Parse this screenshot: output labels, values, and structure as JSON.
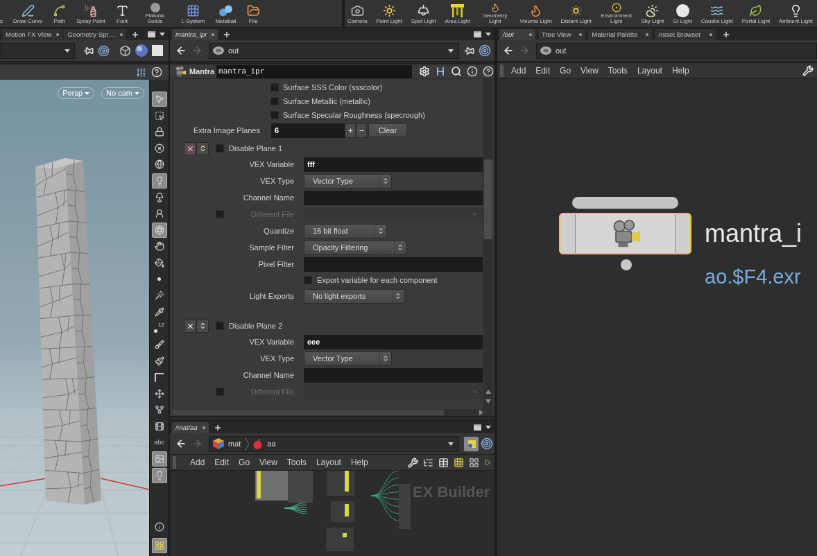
{
  "shelf": {
    "left_tools": [
      {
        "label": "s"
      },
      {
        "label": "Draw Curve"
      },
      {
        "label": "Path"
      },
      {
        "label": "Spray Paint"
      },
      {
        "label": "Font"
      },
      {
        "label": "Platonic Solids"
      },
      {
        "label": "L-System"
      },
      {
        "label": "Metaball"
      },
      {
        "label": "File"
      }
    ],
    "right_tools": [
      {
        "label": "Camera"
      },
      {
        "label": "Point Light"
      },
      {
        "label": "Spot Light"
      },
      {
        "label": "Area Light"
      },
      {
        "label": "Geometry Light"
      },
      {
        "label": "Volume Light"
      },
      {
        "label": "Distant Light"
      },
      {
        "label": "Environment Light"
      },
      {
        "label": "Sky Light"
      },
      {
        "label": "GI Light"
      },
      {
        "label": "Caustic Light"
      },
      {
        "label": "Portal Light"
      },
      {
        "label": "Ambient Light"
      }
    ]
  },
  "viewport_pane": {
    "tabs": [
      {
        "label": "Motion FX View",
        "selected": false
      },
      {
        "label": "Geometry Spr…",
        "selected": false
      }
    ],
    "view_buttons": [
      {
        "label": "Persp"
      },
      {
        "label": "No cam"
      }
    ],
    "toolbar": [
      {
        "kind": "icon",
        "on": true
      },
      {
        "kind": "icon",
        "on": false
      },
      {
        "kind": "icon",
        "on": false
      },
      {
        "kind": "icon",
        "on": false
      },
      {
        "kind": "icon",
        "on": false
      },
      {
        "kind": "icon",
        "on": true
      },
      {
        "kind": "icon",
        "on": false
      },
      {
        "kind": "icon",
        "on": false
      },
      {
        "kind": "icon",
        "on": true
      },
      {
        "kind": "icon",
        "on": false
      },
      {
        "kind": "icon",
        "on": false
      },
      {
        "kind": "icon",
        "on": false
      },
      {
        "kind": "icon",
        "on": false
      },
      {
        "kind": "icon",
        "on": false
      },
      {
        "kind": "icon_label",
        "label": "12",
        "on": false
      },
      {
        "kind": "icon",
        "on": false
      },
      {
        "kind": "icon",
        "on": false
      },
      {
        "kind": "icon",
        "on": false
      },
      {
        "kind": "icon",
        "on": false
      },
      {
        "kind": "icon",
        "on": false
      },
      {
        "kind": "icon",
        "on": false
      },
      {
        "kind": "text",
        "label": "abc",
        "on": false
      },
      {
        "kind": "icon",
        "on": true
      },
      {
        "kind": "icon",
        "on": true
      }
    ],
    "toolbar_bottom": [
      {
        "kind": "icon",
        "on": false
      },
      {
        "kind": "icon",
        "on": true
      }
    ]
  },
  "parameter_pane": {
    "tabs": [
      {
        "label": "mantra_ipr",
        "selected": true
      }
    ],
    "path": {
      "segments": [
        {
          "label": "out"
        }
      ],
      "forward_disabled": true
    },
    "node_type": "Mantra",
    "node_name": "mantra_ipr",
    "checkboxes": [
      {
        "label": "Surface SSS Color (ssscolor)",
        "checked": false
      },
      {
        "label": "Surface Metallic (metallic)",
        "checked": false
      },
      {
        "label": "Surface Specular Roughness (specrough)",
        "checked": false
      }
    ],
    "image_planes": {
      "label": "Extra Image Planes",
      "value": "6",
      "clear_button": "Clear"
    },
    "planes": [
      {
        "title": "Disable Plane 1",
        "checked": false,
        "remove_highlighted": true,
        "params": [
          {
            "kind": "text",
            "label": "VEX Variable",
            "value": "fff"
          },
          {
            "kind": "menu",
            "label": "VEX Type",
            "value": "Vector Type"
          },
          {
            "kind": "text",
            "label": "Channel Name"
          },
          {
            "kind": "file",
            "label": "Different File",
            "checked": false,
            "disabled": true
          },
          {
            "kind": "menu",
            "label": "Quantize",
            "value": "16 bit float"
          },
          {
            "kind": "menu",
            "label": "Sample Filter",
            "value": "Opacity Filtering"
          },
          {
            "kind": "text",
            "label": "Pixel Filter"
          },
          {
            "kind": "checkbox",
            "label": "Export variable for each component",
            "checked": false
          },
          {
            "kind": "menu",
            "label": "Light Exports",
            "value": "No light exports"
          }
        ]
      },
      {
        "title": "Disable Plane 2",
        "checked": false,
        "remove_highlighted": false,
        "params": [
          {
            "kind": "text",
            "label": "VEX Variable",
            "value": "eee"
          },
          {
            "kind": "menu",
            "label": "VEX Type",
            "value": "Vector Type"
          },
          {
            "kind": "text",
            "label": "Channel Name"
          },
          {
            "kind": "file",
            "label": "Different File",
            "checked": false,
            "disabled": true
          }
        ]
      }
    ]
  },
  "material_network_pane": {
    "tabs": [
      {
        "label": "/mat/aa",
        "selected": true
      }
    ],
    "path": {
      "segments": [
        {
          "label": "mat"
        },
        {
          "label": "aa"
        }
      ],
      "forward_disabled": true
    },
    "menu": [
      "Add",
      "Edit",
      "Go",
      "View",
      "Tools",
      "Layout",
      "Help"
    ],
    "canvas_label": "EX Builder"
  },
  "output_network_pane": {
    "tabs": [
      {
        "label": "/out",
        "selected": true
      },
      {
        "label": "Tree View",
        "selected": false
      },
      {
        "label": "Material Palette",
        "selected": false
      },
      {
        "label": "Asset Browser",
        "selected": false
      }
    ],
    "path": {
      "segments": [
        {
          "label": "out"
        }
      ],
      "forward_disabled": true
    },
    "menu": [
      "Add",
      "Edit",
      "Go",
      "View",
      "Tools",
      "Layout",
      "Help"
    ],
    "node": {
      "name": "mantra_i",
      "output": "ao.$F4.exr",
      "selected": true
    }
  }
}
